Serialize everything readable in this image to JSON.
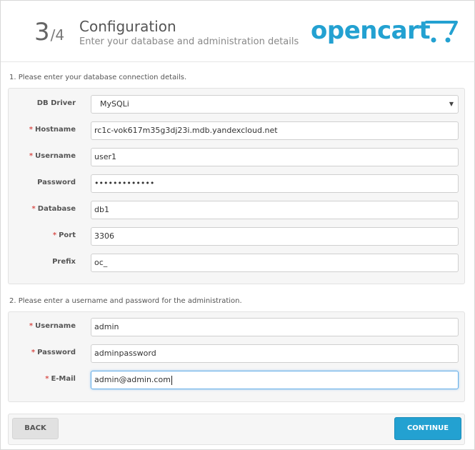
{
  "header": {
    "step_number": "3",
    "step_total": "/4",
    "title": "Configuration",
    "subtitle": "Enter your database and administration details",
    "logo_text": "opencart",
    "logo_color": "#23a1d1"
  },
  "db_section": {
    "title": "1. Please enter your database connection details.",
    "fields": {
      "driver": {
        "label": "DB Driver",
        "required": false,
        "value": "MySQLi"
      },
      "hostname": {
        "label": "Hostname",
        "required": true,
        "value": "rc1c-vok617m35g3dj23i.mdb.yandexcloud.net"
      },
      "username": {
        "label": "Username",
        "required": true,
        "value": "user1"
      },
      "password": {
        "label": "Password",
        "required": false,
        "value": "•••••••••••••"
      },
      "database": {
        "label": "Database",
        "required": true,
        "value": "db1"
      },
      "port": {
        "label": "Port",
        "required": true,
        "value": "3306"
      },
      "prefix": {
        "label": "Prefix",
        "required": false,
        "value": "oc_"
      }
    }
  },
  "admin_section": {
    "title": "2. Please enter a username and password for the administration.",
    "fields": {
      "username": {
        "label": "Username",
        "required": true,
        "value": "admin"
      },
      "password": {
        "label": "Password",
        "required": true,
        "value": "adminpassword"
      },
      "email": {
        "label": "E-Mail",
        "required": true,
        "value": "admin@admin.com"
      }
    }
  },
  "buttons": {
    "back": "BACK",
    "continue": "CONTINUE"
  },
  "required_marker": "*",
  "colors": {
    "accent": "#23a1d1",
    "required": "#d9534f",
    "focus": "#66afe9"
  }
}
